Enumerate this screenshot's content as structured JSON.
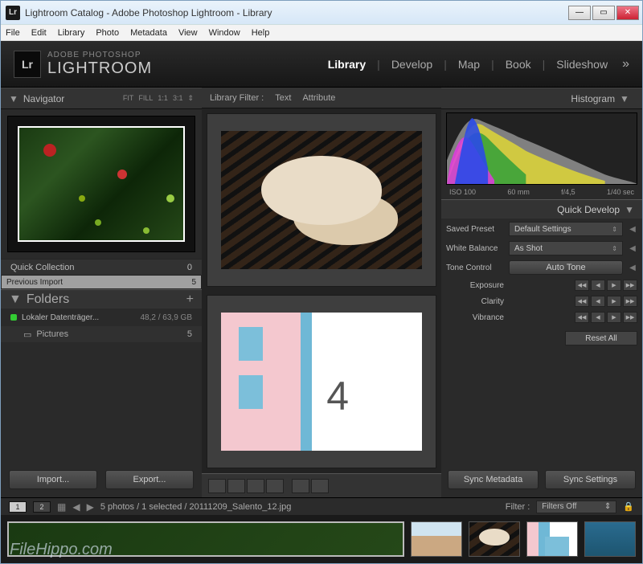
{
  "window": {
    "app_icon": "Lr",
    "title": "Lightroom    Catalog - Adobe Photoshop Lightroom - Library"
  },
  "menubar": [
    "File",
    "Edit",
    "Library",
    "Photo",
    "Metadata",
    "View",
    "Window",
    "Help"
  ],
  "brand": {
    "sup": "ADOBE PHOTOSHOP",
    "main": "LIGHTROOM",
    "logo": "Lr"
  },
  "modules": [
    "Library",
    "Develop",
    "Map",
    "Book",
    "Slideshow"
  ],
  "modules_active": "Library",
  "navigator": {
    "title": "Navigator",
    "opts": [
      "FIT",
      "FILL",
      "1:1",
      "3:1"
    ]
  },
  "catalog": {
    "quick_collection": {
      "label": "Quick Collection",
      "count": "0"
    },
    "previous_import": {
      "label": "Previous Import",
      "count": "5"
    }
  },
  "folders": {
    "title": "Folders",
    "drive": {
      "name": "Lokaler Datenträger...",
      "usage": "48,2 / 63,9 GB"
    },
    "subfolder": {
      "name": "Pictures",
      "count": "5"
    }
  },
  "import_btn": "Import...",
  "export_btn": "Export...",
  "library_filter": {
    "label": "Library Filter :",
    "tabs": [
      "Text",
      "Attribute"
    ]
  },
  "grid_cell_index": "4",
  "histogram": {
    "title": "Histogram",
    "labels": [
      "ISO 100",
      "60 mm",
      "f/4,5",
      "1/40 sec"
    ]
  },
  "quick_develop": {
    "title": "Quick Develop",
    "saved_preset": {
      "label": "Saved Preset",
      "value": "Default Settings"
    },
    "white_balance": {
      "label": "White Balance",
      "value": "As Shot"
    },
    "tone_control": {
      "label": "Tone Control",
      "button": "Auto Tone"
    },
    "exposure": "Exposure",
    "clarity": "Clarity",
    "vibrance": "Vibrance",
    "reset": "Reset All"
  },
  "sync_metadata": "Sync Metadata",
  "sync_settings": "Sync Settings",
  "filmstrip": {
    "pages": [
      "1",
      "2"
    ],
    "status": "5 photos / 1 selected / 20111209_Salento_12.jpg",
    "filter_label": "Filter :",
    "filter_value": "Filters Off"
  },
  "watermark": "FileHippo.com"
}
